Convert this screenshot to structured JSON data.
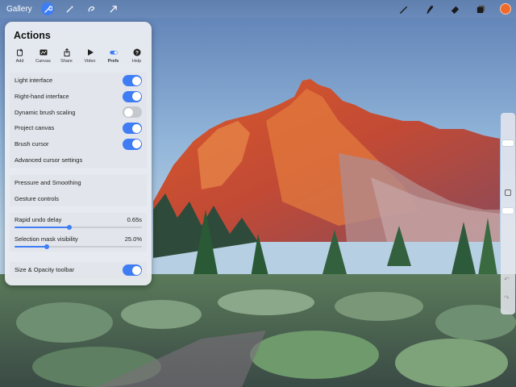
{
  "topbar": {
    "gallery_label": "Gallery",
    "left_tools": [
      {
        "icon": "wrench-icon",
        "active": true
      },
      {
        "icon": "magic-wand-icon",
        "active": false
      },
      {
        "icon": "selection-icon",
        "active": false
      },
      {
        "icon": "transform-arrow-icon",
        "active": false
      }
    ],
    "right_tools": [
      "brush-icon",
      "smudge-icon",
      "eraser-icon",
      "layers-icon"
    ],
    "current_color": "#f06a2a"
  },
  "actions": {
    "title": "Actions",
    "tabs": [
      {
        "label": "Add",
        "icon": "add-icon"
      },
      {
        "label": "Canvas",
        "icon": "canvas-icon"
      },
      {
        "label": "Share",
        "icon": "share-icon"
      },
      {
        "label": "Video",
        "icon": "play-icon"
      },
      {
        "label": "Prefs",
        "icon": "toggle-icon",
        "active": true
      },
      {
        "label": "Help",
        "icon": "help-icon"
      }
    ],
    "prefs_toggles": [
      {
        "label": "Light interface",
        "on": true
      },
      {
        "label": "Right-hand interface",
        "on": true
      },
      {
        "label": "Dynamic brush scaling",
        "on": false
      },
      {
        "label": "Project canvas",
        "on": true
      },
      {
        "label": "Brush cursor",
        "on": true
      }
    ],
    "advanced_cursor": "Advanced cursor settings",
    "pressure_smoothing": "Pressure and Smoothing",
    "gesture_controls": "Gesture controls",
    "sliders": [
      {
        "label": "Rapid undo delay",
        "value": "0.65s",
        "fraction": 0.43
      },
      {
        "label": "Selection mask visibility",
        "value": "25.0%",
        "fraction": 0.25
      }
    ],
    "size_opacity": {
      "label": "Size & Opacity toolbar",
      "on": true
    }
  },
  "colors": {
    "accent": "#3f7df5",
    "toggle_off": "#c5c8ce"
  }
}
